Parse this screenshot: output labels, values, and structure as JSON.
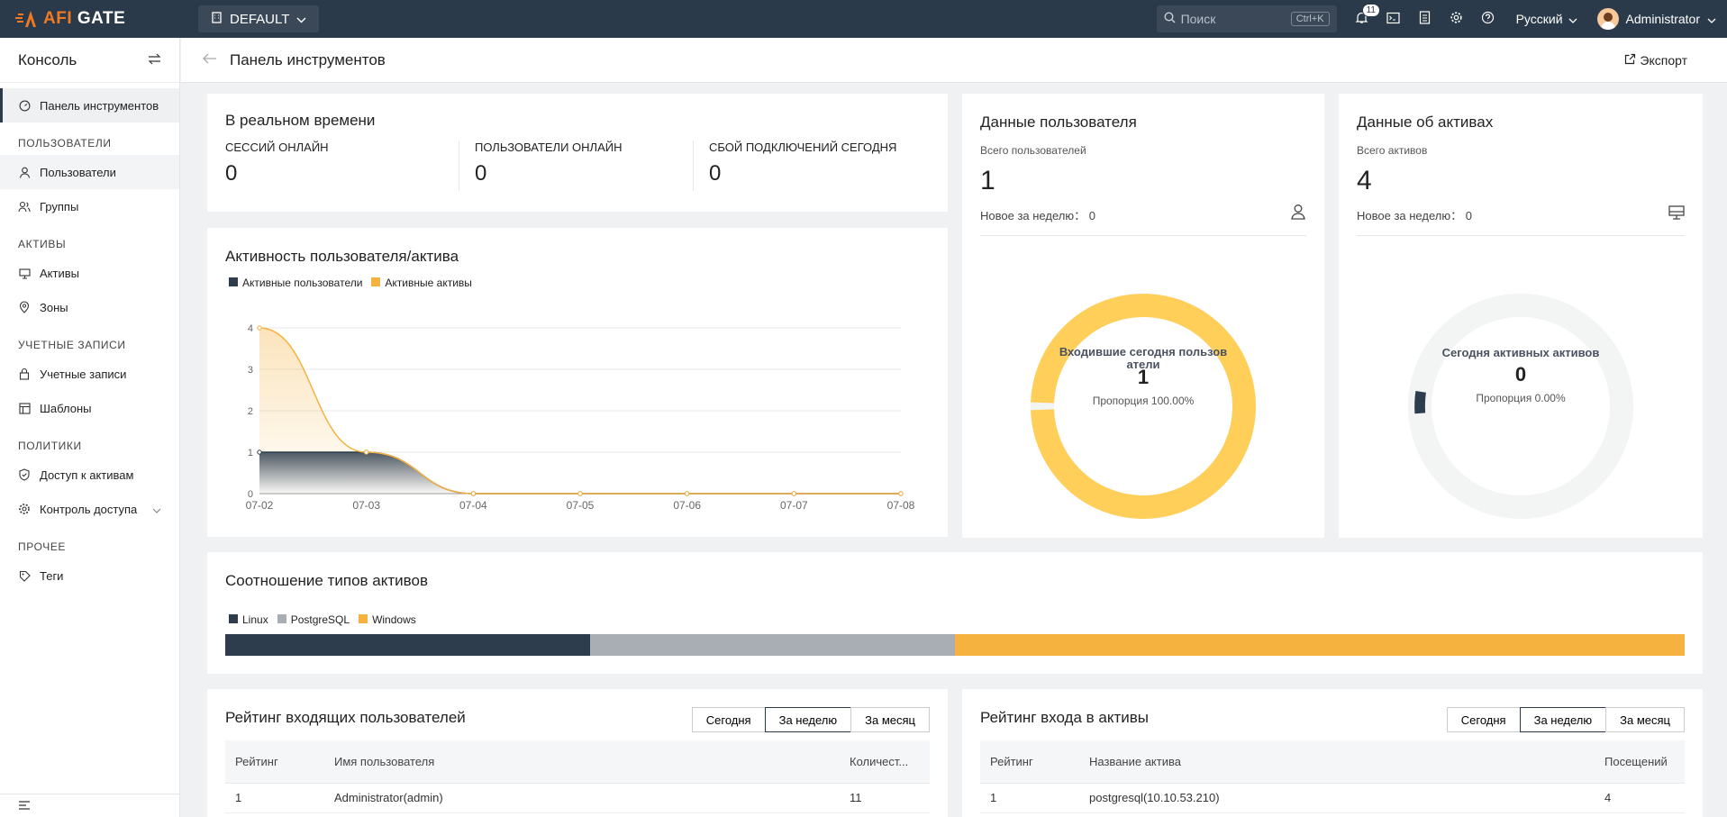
{
  "topbar": {
    "logo_prefix": "AFI",
    "logo_suffix": "GATE",
    "org": "DEFAULT",
    "search_placeholder": "Поиск",
    "search_shortcut": "Ctrl+K",
    "notification_count": "11",
    "language": "Русский",
    "user": "Administrator"
  },
  "sidebar": {
    "title": "Консоль",
    "dashboard": "Панель инструментов",
    "sections": {
      "users": "ПОЛЬЗОВАТЕЛИ",
      "assets": "АКТИВЫ",
      "accounts": "УЧЕТНЫЕ ЗАПИСИ",
      "policies": "ПОЛИТИКИ",
      "other": "ПРОЧЕЕ"
    },
    "items": {
      "users": "Пользователи",
      "groups": "Группы",
      "assets": "Активы",
      "zones": "Зоны",
      "accounts": "Учетные записи",
      "templates": "Шаблоны",
      "asset_access": "Доступ к активам",
      "access_control": "Контроль доступа",
      "tags": "Теги"
    }
  },
  "header": {
    "title": "Панель инструментов",
    "export": "Экспорт"
  },
  "realtime": {
    "title": "В реальном времени",
    "metrics": [
      {
        "label": "СЕССИЙ ОНЛАЙН",
        "value": "0"
      },
      {
        "label": "ПОЛЬЗОВАТЕЛИ ОНЛАЙН",
        "value": "0"
      },
      {
        "label": "СБОЙ ПОДКЛЮЧЕНИЙ СЕГОДНЯ",
        "value": "0"
      }
    ]
  },
  "user_data": {
    "title": "Данные пользователя",
    "total_label": "Всего пользователей",
    "total": "1",
    "new_week_label": "Новое за неделю：",
    "new_week": "0",
    "ring_title_1": "Входившие сегодня пользов",
    "ring_title_2": "атели",
    "ring_value": "1",
    "ring_ratio": "Пропорция 100.00%",
    "ring_fraction": 1.0
  },
  "asset_data": {
    "title": "Данные об активах",
    "total_label": "Всего активов",
    "total": "4",
    "new_week_label": "Новое за неделю：",
    "new_week": "0",
    "ring_title": "Сегодня активных активов",
    "ring_value": "0",
    "ring_ratio": "Пропорция 0.00%",
    "ring_fraction": 0.0
  },
  "activity": {
    "title": "Активность пользователя/актива",
    "legend": [
      "Активные пользователи",
      "Активные активы"
    ]
  },
  "asset_types": {
    "title": "Соотношение типов активов",
    "legend": [
      "Linux",
      "PostgreSQL",
      "Windows"
    ],
    "fractions": [
      0.25,
      0.25,
      0.5
    ]
  },
  "user_rank": {
    "title": "Рейтинг входящих пользователей",
    "tabs": [
      "Сегодня",
      "За неделю",
      "За месяц"
    ],
    "columns": [
      "Рейтинг",
      "Имя пользователя",
      "Количест..."
    ],
    "rows": [
      [
        "1",
        "Administrator(admin)",
        "11"
      ]
    ]
  },
  "asset_rank": {
    "title": "Рейтинг входа в активы",
    "tabs": [
      "Сегодня",
      "За неделю",
      "За месяц"
    ],
    "columns": [
      "Рейтинг",
      "Название актива",
      "Посещений"
    ],
    "rows": [
      [
        "1",
        "postgresql(10.10.53.210)",
        "4"
      ]
    ]
  },
  "colors": {
    "dark": "#2d3d4d",
    "accent": "#f5b23e",
    "ring_user": "#ffcf5a",
    "gray": "#a9aeb4"
  },
  "chart_data": {
    "type": "area",
    "x": [
      "07-02",
      "07-03",
      "07-04",
      "07-05",
      "07-06",
      "07-07",
      "07-08"
    ],
    "series": [
      {
        "name": "Активные пользователи",
        "values": [
          1,
          1,
          0,
          0,
          0,
          0,
          0
        ]
      },
      {
        "name": "Активные активы",
        "values": [
          4,
          1,
          0,
          0,
          0,
          0,
          0
        ]
      }
    ],
    "xlabel": "",
    "ylabel": "",
    "ylim": [
      0,
      4
    ],
    "yticks": [
      0,
      1,
      2,
      3,
      4
    ],
    "grid": true,
    "legend": "top-left"
  }
}
